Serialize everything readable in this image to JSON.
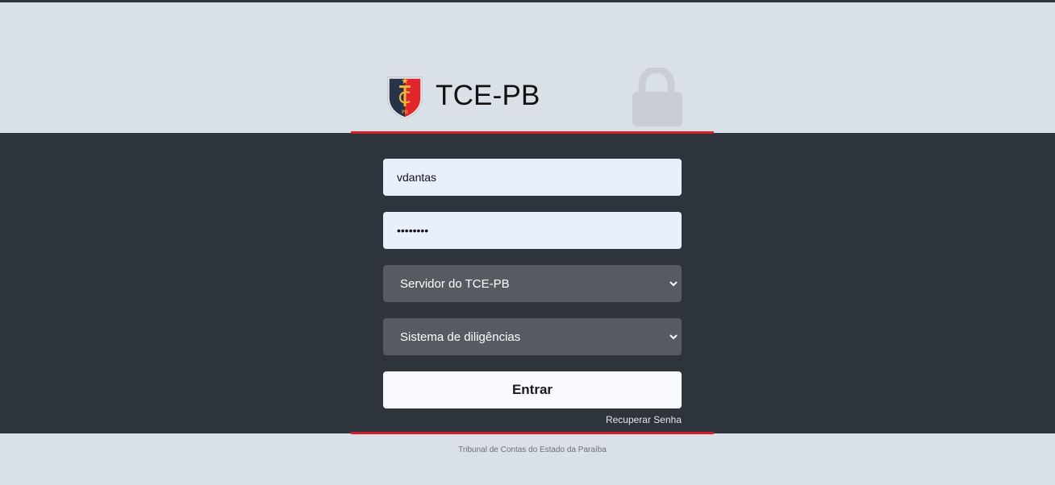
{
  "header": {
    "title": "TCE-PB",
    "logo_icon": "tce-pb-shield-logo",
    "lock_icon": "lock-icon"
  },
  "login_form": {
    "username_value": "vdantas",
    "password_value": "••••••••",
    "user_type_selected": "Servidor do TCE-PB",
    "system_selected": "Sistema de diligências",
    "submit_label": "Entrar",
    "recover_label": "Recuperar Senha"
  },
  "footer": {
    "text": "Tribunal de Contas do Estado da Paraíba"
  },
  "colors": {
    "header_bg": "#dae0e8",
    "main_bg": "#2e343c",
    "accent_red": "#d41f26",
    "input_bg": "#e8f0fe",
    "select_bg": "#565b63",
    "button_bg": "#f7f9fc"
  }
}
